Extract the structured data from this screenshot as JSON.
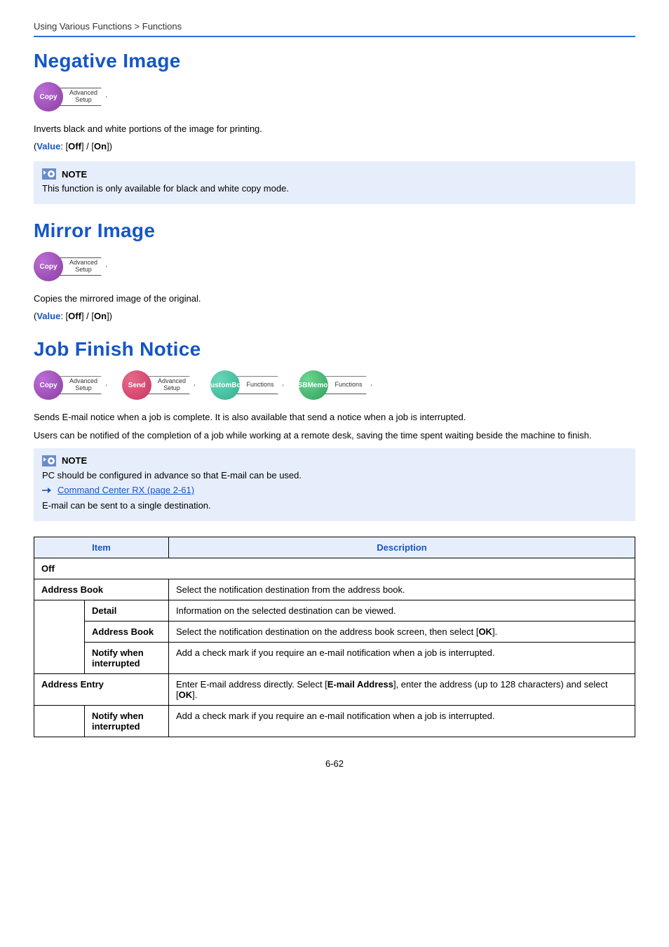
{
  "breadcrumb": "Using Various Functions > Functions",
  "sections": {
    "negative": {
      "title": "Negative Image",
      "badges": [
        {
          "circle": "Copy",
          "class": "bg-purple",
          "tag": "Advanced\nSetup"
        }
      ],
      "desc": "Inverts black and white portions of the image for printing.",
      "value_label": "Value",
      "value_opts": ": [Off] / [On])",
      "note_label": "NOTE",
      "note_text": "This function is only available for black and white copy mode."
    },
    "mirror": {
      "title": "Mirror Image",
      "badges": [
        {
          "circle": "Copy",
          "class": "bg-purple",
          "tag": "Advanced\nSetup"
        }
      ],
      "desc": "Copies the mirrored image of the original.",
      "value_label": "Value",
      "value_opts": ": [Off] / [On])"
    },
    "jobfinish": {
      "title": "Job Finish Notice",
      "badges": [
        {
          "circle": "Copy",
          "class": "bg-purple",
          "tag": "Advanced\nSetup"
        },
        {
          "circle": "Send",
          "class": "bg-red",
          "tag": "Advanced\nSetup"
        },
        {
          "circle": "Custom\nBox",
          "class": "bg-teal",
          "tag": "Functions"
        },
        {
          "circle": "USB\nMemory",
          "class": "bg-green",
          "tag": "Functions"
        }
      ],
      "desc1": "Sends E-mail notice when a job is complete. It is also available that send a notice when a job is interrupted.",
      "desc2": "Users can be notified of the completion of a job while working at a remote desk, saving the time spent waiting beside the machine to finish.",
      "note_label": "NOTE",
      "note_text1": "PC should be configured in advance so that E-mail can be used.",
      "link_text": "Command Center RX (page 2-61)",
      "note_text2": "E-mail can be sent to a single destination."
    }
  },
  "table": {
    "headers": {
      "item": "Item",
      "desc": "Description"
    },
    "rows": {
      "off": "Off",
      "abook": {
        "label": "Address Book",
        "desc": "Select the notification destination from the address book.",
        "sub": {
          "detail": {
            "label": "Detail",
            "desc": "Information on the selected destination can be viewed."
          },
          "abook2": {
            "label": "Address Book",
            "desc": "Select the notification destination on the address book screen, then select [OK]."
          },
          "notify": {
            "label": "Notify when interrupted",
            "desc": "Add a check mark if you require an e-mail notification when a job is interrupted."
          }
        }
      },
      "aentry": {
        "label": "Address Entry",
        "desc": "Enter E-mail address directly. Select [E-mail Address], enter the address (up to 128 characters) and select [OK].",
        "sub": {
          "notify": {
            "label": "Notify when interrupted",
            "desc": "Add a check mark if you require an e-mail notification when a job is interrupted."
          }
        }
      }
    }
  },
  "page_number": "6-62"
}
